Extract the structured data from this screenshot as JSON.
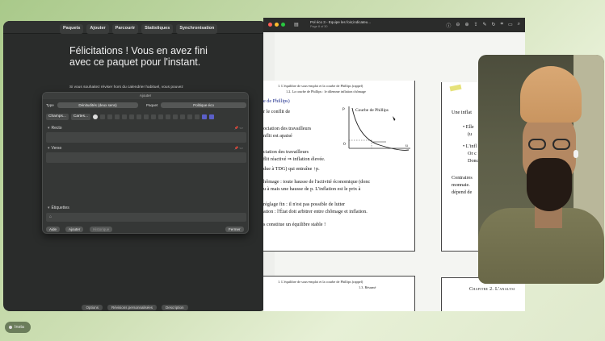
{
  "anki": {
    "nav": [
      "Paquets",
      "Ajouter",
      "Parcourir",
      "Statistiques",
      "Synchronisation"
    ],
    "congrats_title": "Félicitations ! Vous en avez fini avec ce paquet pour l'instant.",
    "congrats_sub": "Si vous souhaitez réviser hors du calendrier habituel, vous pouvez",
    "bottom_buttons": [
      "Options",
      "Révisions personnalisées",
      "Description"
    ]
  },
  "add_dialog": {
    "title": "Ajouter",
    "type_label": "Type",
    "type_value": "Dénitudités (deux sens)",
    "deck_label": "Paquet",
    "deck_value": "Politique éco",
    "fields_button": "Champs...",
    "cards_button": "Cartes...",
    "field_front": "Recto",
    "field_back": "Verso",
    "tags_label": "Étiquettes",
    "btn_help": "Aide",
    "btn_add": "Ajouter",
    "btn_history": "Historique",
    "btn_close": "Fermer"
  },
  "pdf": {
    "title": "Pol éco 3 - Equipe les fois;indicateu...",
    "subtitle": "Page 8 of 30",
    "page1_header_1": "1.   L'équilibre de sous-emploi et la courbe de Phillips (rappel)",
    "page1_header_2": "1.2.   La courbe de Phillips : le dilemme inflation chômage",
    "page1_lines": [
      "e de Phillips)",
      "r le conflit de",
      "ociation des travailleurs",
      "nflit est apaisé",
      "ciation des travailleurs",
      "flit réactivé ⇒ inflation élevée.",
      "due à TDG) qui entraîne ↑p.",
      "hômage : toute hausse de l'activité économique (donc",
      "u à mais une hausse de p. L'inflation est le prix à",
      "réglage fin : il n'est pas possible de lutter",
      "ation : l'État doit arbitrer entre chômage et inflation.",
      "s constitue un équilibre stable !"
    ],
    "graph_label": "Courbe de Phillips",
    "graph_axis_p": "p",
    "graph_axis_u": "u",
    "graph_origin": "0",
    "page2_header_1": "1.   L'équilibre de sous-emploi et la courbe de Phillips (rappel)",
    "page2_header_2": "1.3.   Résumé",
    "page3_lines": [
      "Une inflat",
      "• Elle",
      "(u",
      "• L'infl",
      "Or c",
      "Donc",
      "Contraires",
      "monnaie.",
      "dépend de"
    ],
    "page4_title": "Chapitre 2. L'analysi"
  },
  "chip": {
    "label": "Insta"
  }
}
